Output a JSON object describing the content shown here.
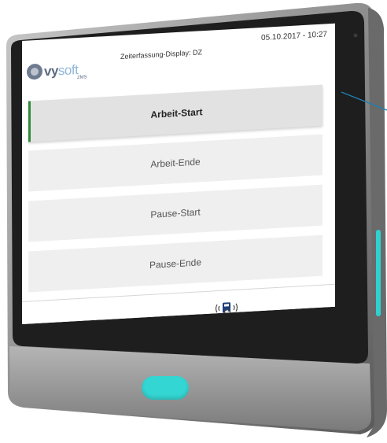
{
  "header": {
    "device_title": "Zeiterfassung-Display: DZ",
    "datetime": "05.10.2017 - 10:27"
  },
  "logo": {
    "brand_main": "vy",
    "brand_light": "soft",
    "brand_sub": "ZMS"
  },
  "buttons": [
    {
      "label": "Arbeit-Start",
      "active": true
    },
    {
      "label": "Arbeit-Ende",
      "active": false
    },
    {
      "label": "Pause-Start",
      "active": false
    },
    {
      "label": "Pause-Ende",
      "active": false
    }
  ],
  "footer": {
    "icon": "nfc-card-tap-icon"
  },
  "colors": {
    "accent": "#2f8c3c",
    "button_bg": "#efefef",
    "led": "#34d6d3",
    "bezel": "#1e1e1e",
    "frame": "#8d8d8d"
  },
  "device_icons": [
    "home-key",
    "side-led-strip",
    "camera-dot",
    "callout-line"
  ]
}
